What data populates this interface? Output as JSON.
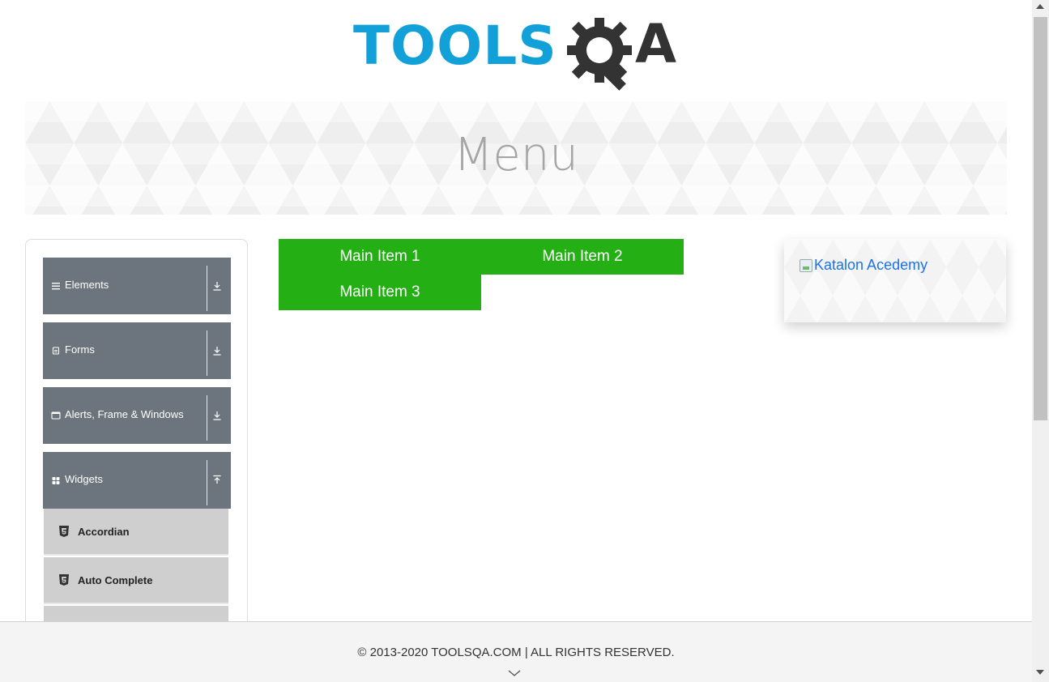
{
  "logo": {
    "alt": "TOOLSQA",
    "brand_text_blue": "TOOLS",
    "brand_text_dark": "A",
    "icon": "gear-magnifier-icon"
  },
  "banner": {
    "title": "Menu"
  },
  "sidebar": {
    "groups": [
      {
        "label": "Elements",
        "icon": "hamburger-icon",
        "arrow": "download-arrow-icon",
        "expanded": false
      },
      {
        "label": "Forms",
        "icon": "form-icon",
        "arrow": "download-arrow-icon",
        "expanded": false
      },
      {
        "label": "Alerts, Frame & Windows",
        "icon": "window-icon",
        "arrow": "download-arrow-icon",
        "expanded": false
      },
      {
        "label": "Widgets",
        "icon": "grid-icon",
        "arrow": "upload-arrow-icon",
        "expanded": true
      }
    ],
    "widgets_items": [
      {
        "label": "Accordian",
        "icon": "html5-icon"
      },
      {
        "label": "Auto Complete",
        "icon": "html5-icon"
      },
      {
        "label": "",
        "icon": "html5-icon"
      }
    ]
  },
  "menu": {
    "items": [
      {
        "label": "Main Item 1"
      },
      {
        "label": "Main Item 2"
      },
      {
        "label": "Main Item 3"
      }
    ],
    "color": "#24af15"
  },
  "ad": {
    "alt_text": "Katalon Acedemy",
    "icon": "broken-image-icon"
  },
  "footer": {
    "text": "© 2013-2020 TOOLSQA.COM | ALL RIGHTS RESERVED.",
    "icon": "chevron-down-icon"
  },
  "colors": {
    "accent_blue": "#12a0d8",
    "sidebar_group": "#6c757d",
    "sidebar_item": "#cfcfcf",
    "link": "#1a73e8"
  }
}
